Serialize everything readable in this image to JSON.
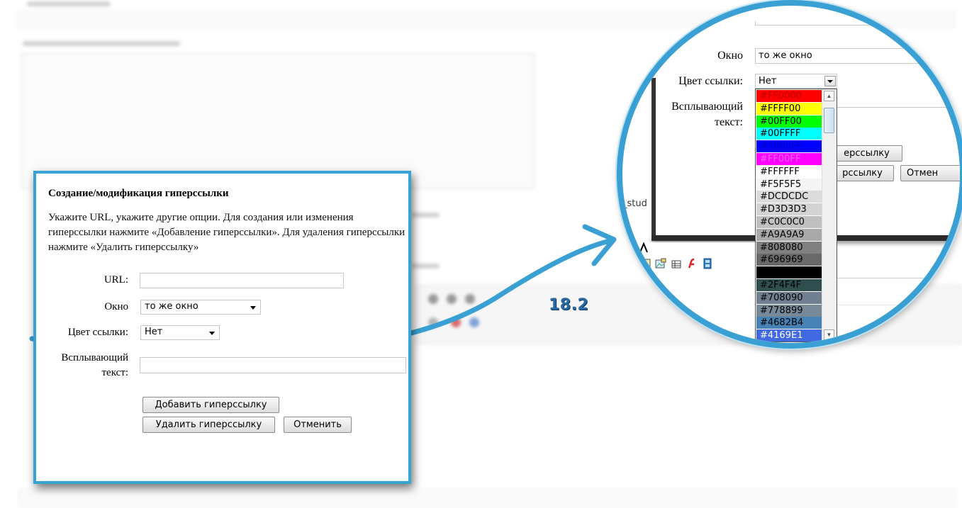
{
  "dialog": {
    "title": "Создание/модификация гиперссылки",
    "description": "Укажите URL, укажите другие опции. Для создания или изменения гиперссылки нажмите «Добавление гиперссылки». Для удаления гиперссылки нажмите «Удалить гиперссылку»",
    "url_label": "URL:",
    "url_value": "",
    "window_label": "Окно",
    "window_value": "то же окно",
    "color_label": "Цвет ссылки:",
    "color_value": "Нет",
    "tooltip_label_line1": "Всплывающий",
    "tooltip_label_line2": "текст:",
    "tooltip_value": "",
    "add_button": "Добавить гиперссылку",
    "delete_button": "Удалить гиперссылку",
    "cancel_button": "Отменить"
  },
  "callout": {
    "label": "18.2",
    "color": "#3aa0d3"
  },
  "magnifier": {
    "window_label": "Окно",
    "window_value": "то же окно",
    "color_label": "Цвет ссылки:",
    "color_value": "Нет",
    "tooltip_label_line1": "Всплывающий",
    "tooltip_label_line2": "текст:",
    "partial_add_button": "ерссылку",
    "partial_delete_button": "рссылку",
    "partial_cancel_button": "Отмен",
    "partial_path_text": "e_stud",
    "color_options": [
      {
        "label": "#FF0000",
        "bg": "#FF0000",
        "fg": "#c00000"
      },
      {
        "label": "#FFFF00",
        "bg": "#FFFF00",
        "fg": "#000000"
      },
      {
        "label": "#00FF00",
        "bg": "#00FF00",
        "fg": "#000000"
      },
      {
        "label": "#00FFFF",
        "bg": "#00FFFF",
        "fg": "#000000"
      },
      {
        "label": "#0000FF",
        "bg": "#0000FF",
        "fg": "#0000c0"
      },
      {
        "label": "#FF00FF",
        "bg": "#FF00FF",
        "fg": "#ff66ff"
      },
      {
        "label": "#FFFFFF",
        "bg": "#FFFFFF",
        "fg": "#000000"
      },
      {
        "label": "#F5F5F5",
        "bg": "#F5F5F5",
        "fg": "#000000"
      },
      {
        "label": "#DCDCDC",
        "bg": "#DCDCDC",
        "fg": "#000000"
      },
      {
        "label": "#D3D3D3",
        "bg": "#D3D3D3",
        "fg": "#000000"
      },
      {
        "label": "#C0C0C0",
        "bg": "#C0C0C0",
        "fg": "#000000"
      },
      {
        "label": "#A9A9A9",
        "bg": "#A9A9A9",
        "fg": "#000000"
      },
      {
        "label": "#808080",
        "bg": "#808080",
        "fg": "#000000"
      },
      {
        "label": "#696969",
        "bg": "#696969",
        "fg": "#000000"
      },
      {
        "label": "",
        "bg": "#000000",
        "fg": "#000000"
      },
      {
        "label": "#2F4F4F",
        "bg": "#2F4F4F",
        "fg": "#000000"
      },
      {
        "label": "#708090",
        "bg": "#708090",
        "fg": "#000000"
      },
      {
        "label": "#778899",
        "bg": "#778899",
        "fg": "#000000"
      },
      {
        "label": "#4682B4",
        "bg": "#4682B4",
        "fg": "#000000"
      },
      {
        "label": "#4169E1",
        "bg": "#4169E1",
        "fg": "#ffffff"
      }
    ]
  }
}
